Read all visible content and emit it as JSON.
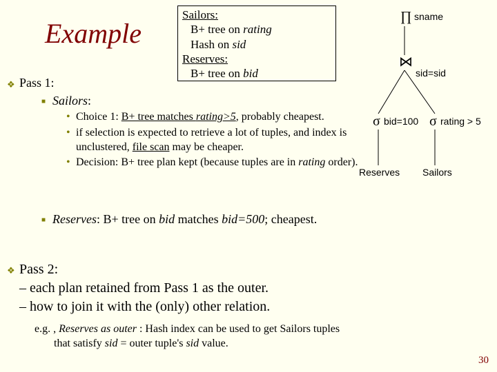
{
  "title": "Example",
  "box": {
    "sailors_header": "Sailors:",
    "sailors_line1_prefix": "B+ tree on ",
    "sailors_line1_em": "rating",
    "sailors_line2_prefix": "Hash on ",
    "sailors_line2_em": "sid",
    "reserves_header": "Reserves:",
    "reserves_line1_prefix": "B+ tree on ",
    "reserves_line1_em": "bid"
  },
  "pass1_label": "Pass 1:",
  "sailors_bullet": {
    "label": "Sailors",
    "suffix": ":"
  },
  "sub": {
    "c1_a": "Choice 1: ",
    "c1_b": "B+ tree matches ",
    "c1_c": "rating>5",
    "c1_d": ", probably cheapest.",
    "c2_a": "if selection is expected to retrieve a lot of tuples, and index is unclustered, ",
    "c2_b": "file scan",
    "c2_c": " may be cheaper.",
    "c3_a": "Decision: B+ tree plan kept (because tuples are in ",
    "c3_b": "rating",
    "c3_c": " order).",
    "reserves_em": "Reserves",
    "reserves_a": ":  B+ tree on ",
    "reserves_b": "bid",
    "reserves_c": " matches ",
    "reserves_d": "bid=500",
    "reserves_e": "; cheapest."
  },
  "pass2": {
    "line1": "Pass 2:",
    "line2": "– each plan retained from Pass 1 as the outer.",
    "line3": "– how to join it with the (only) other relation."
  },
  "eg": {
    "prefix": "e.g. , ",
    "em1": "Reserves as outer",
    "mid": " :  Hash index can be used to get Sailors tuples",
    "line2_a": "that satisfy ",
    "line2_b": "sid",
    "line2_c": " = outer tuple's ",
    "line2_d": "sid",
    "line2_e": " value."
  },
  "diagram": {
    "sname": "sname",
    "sidsid": "sid=sid",
    "bid100": "bid=100",
    "rating5": "rating > 5",
    "reserves": "Reserves",
    "sailors": "Sailors"
  },
  "page_number": "30"
}
